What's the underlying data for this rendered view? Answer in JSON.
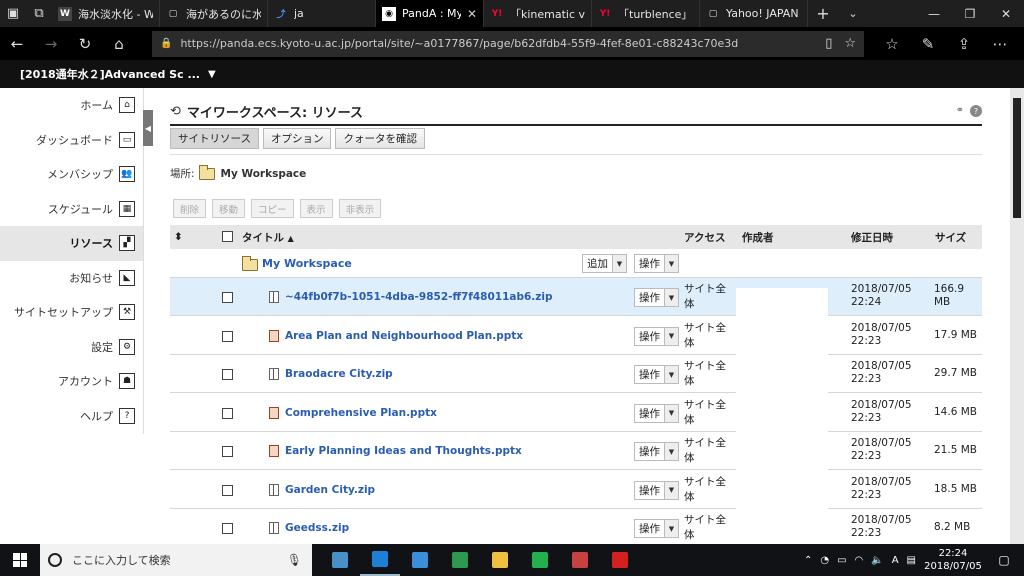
{
  "browser": {
    "tabs": [
      {
        "title": "海水淡水化 - Wil",
        "favicon": "W",
        "fav_color": "#ffffff",
        "fav_bg": "#444444"
      },
      {
        "title": "海があるのに水不足",
        "favicon": "doc-icon",
        "fav_color": "#dddddd",
        "fav_bg": "transparent"
      },
      {
        "title": "ja",
        "favicon": "translate-icon",
        "fav_color": "#4a8cf0",
        "fav_bg": "transparent"
      },
      {
        "title": "PandA : My W",
        "favicon": "panda-icon",
        "fav_color": "#000000",
        "fav_bg": "#ffffff",
        "active": true
      },
      {
        "title": "「kinematic visco",
        "favicon": "Y!",
        "fav_color": "#ff0033",
        "fav_bg": "transparent"
      },
      {
        "title": "「turblence」の検",
        "favicon": "Y!",
        "fav_color": "#ff0033",
        "fav_bg": "transparent"
      },
      {
        "title": "Yahoo! JAPAN",
        "favicon": "doc-icon",
        "fav_color": "#dddddd",
        "fav_bg": "transparent"
      }
    ],
    "url": "https://panda.ecs.kyoto-u.ac.jp/portal/site/~a0177867/page/b62dfdb4-55f9-4fef-8e01-c88243c70e3d"
  },
  "site": {
    "title": "[2018通年水２]Advanced Sc ..."
  },
  "nav": {
    "items": [
      {
        "label": "ホーム",
        "icon": "home-icon",
        "glyph": "⌂"
      },
      {
        "label": "ダッシュボード",
        "icon": "dashboard-icon",
        "glyph": "▭"
      },
      {
        "label": "メンバシップ",
        "icon": "members-icon",
        "glyph": "👥"
      },
      {
        "label": "スケジュール",
        "icon": "calendar-icon",
        "glyph": "▦"
      },
      {
        "label": "リソース",
        "icon": "resources-icon",
        "glyph": "▞",
        "active": true
      },
      {
        "label": "お知らせ",
        "icon": "announcement-icon",
        "glyph": "◣"
      },
      {
        "label": "サイトセットアップ",
        "icon": "site-setup-icon",
        "glyph": "⚒"
      },
      {
        "label": "設定",
        "icon": "settings-icon",
        "glyph": "⚙"
      },
      {
        "label": "アカウント",
        "icon": "account-icon",
        "glyph": "☗"
      },
      {
        "label": "ヘルプ",
        "icon": "help-icon",
        "glyph": "?"
      }
    ]
  },
  "main": {
    "page_title": "マイワークスペース: リソース",
    "toolbar": [
      "サイトリソース",
      "オプション",
      "クォータを確認"
    ],
    "location_label": "場所:",
    "location_value": "My Workspace",
    "actions": [
      "削除",
      "移動",
      "コピー",
      "表示",
      "非表示"
    ],
    "columns": {
      "title": "タイトル",
      "sort": "▲",
      "access": "アクセス",
      "creator": "作成者",
      "modified": "修正日時",
      "size": "サイズ"
    },
    "folder_row": {
      "name": "My Workspace",
      "add": "追加",
      "action": "操作"
    },
    "rows": [
      {
        "name": "~44fb0f7b-1051-4dba-9852-ff7f48011ab6.zip",
        "type": "zip",
        "action": "操作",
        "access": "サイト全体",
        "date": "2018/07/05",
        "time": "22:24",
        "size": "166.9",
        "size_unit": "MB",
        "highlight": true
      },
      {
        "name": "Area Plan and Neighbourhood Plan.pptx",
        "type": "ppt",
        "action": "操作",
        "access": "サイト全体",
        "date": "2018/07/05",
        "time": "22:23",
        "size": "17.9 MB",
        "size_unit": ""
      },
      {
        "name": "Braodacre City.zip",
        "type": "zip",
        "action": "操作",
        "access": "サイト全体",
        "date": "2018/07/05",
        "time": "22:23",
        "size": "29.7 MB",
        "size_unit": ""
      },
      {
        "name": "Comprehensive Plan.pptx",
        "type": "ppt",
        "action": "操作",
        "access": "サイト全体",
        "date": "2018/07/05",
        "time": "22:23",
        "size": "14.6 MB",
        "size_unit": ""
      },
      {
        "name": "Early Planning Ideas and Thoughts.pptx",
        "type": "ppt",
        "action": "操作",
        "access": "サイト全体",
        "date": "2018/07/05",
        "time": "22:23",
        "size": "21.5 MB",
        "size_unit": ""
      },
      {
        "name": "Garden City.zip",
        "type": "zip",
        "action": "操作",
        "access": "サイト全体",
        "date": "2018/07/05",
        "time": "22:23",
        "size": "18.5 MB",
        "size_unit": ""
      },
      {
        "name": "Geedss.zip",
        "type": "zip",
        "action": "操作",
        "access": "サイト全体",
        "date": "2018/07/05",
        "time": "22:23",
        "size": "8.2 MB",
        "size_unit": ""
      }
    ]
  },
  "taskbar": {
    "search_placeholder": "ここに入力して検索",
    "apps": [
      {
        "name": "taskview-app",
        "color": "#4a90c8"
      },
      {
        "name": "edge-app",
        "color": "#1e7fd6",
        "active": true
      },
      {
        "name": "explorer-pc-app",
        "color": "#3a8fd8"
      },
      {
        "name": "green-app",
        "color": "#2e9a50"
      },
      {
        "name": "file-explorer-app",
        "color": "#f0c040"
      },
      {
        "name": "line-app",
        "color": "#22b14c"
      },
      {
        "name": "snip-app",
        "color": "#c84040"
      },
      {
        "name": "acrobat-app",
        "color": "#d42020"
      }
    ],
    "tray_text": "A",
    "clock_time": "22:24",
    "clock_date": "2018/07/05"
  }
}
